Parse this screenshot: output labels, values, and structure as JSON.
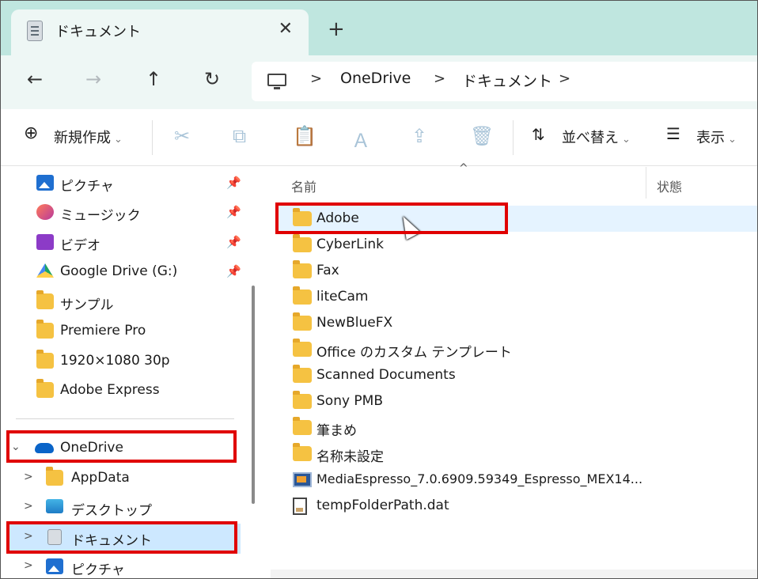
{
  "tab": {
    "title": "ドキュメント",
    "close": "✕",
    "new_tab": "+"
  },
  "nav": {
    "back": "←",
    "forward": "→",
    "up": "↑",
    "refresh": "↻",
    "breadcrumb": [
      "OneDrive",
      "ドキュメント"
    ],
    "separator": ">"
  },
  "toolbar": {
    "new_label": "新規作成",
    "cut_icon": "✂",
    "copy_icon": "⧉",
    "paste_icon": "📋",
    "rename_icon": "Ａ",
    "share_icon": "⇪",
    "delete_icon": "🗑",
    "sort_label": "並べ替え",
    "view_label": "表示",
    "chevron": "⌄"
  },
  "sidebar": {
    "quick_access": [
      {
        "label": "ピクチャ",
        "icon": "pictures-icon",
        "pinned": true
      },
      {
        "label": "ミュージック",
        "icon": "music-icon",
        "pinned": true
      },
      {
        "label": "ビデオ",
        "icon": "videos-icon",
        "pinned": true
      },
      {
        "label": "Google Drive (G:)",
        "icon": "google-drive-icon",
        "pinned": true
      },
      {
        "label": "サンプル",
        "icon": "folder-icon",
        "pinned": false
      },
      {
        "label": "Premiere Pro",
        "icon": "folder-icon",
        "pinned": false
      },
      {
        "label": "1920×1080 30p",
        "icon": "folder-icon",
        "pinned": false
      },
      {
        "label": "Adobe Express",
        "icon": "folder-icon",
        "pinned": false
      }
    ],
    "onedrive": {
      "label": "OneDrive",
      "expanded": true
    },
    "onedrive_children": [
      {
        "label": "AppData",
        "icon": "folder-icon"
      },
      {
        "label": "デスクトップ",
        "icon": "desktop-icon"
      },
      {
        "label": "ドキュメント",
        "icon": "documents-icon",
        "selected": true
      },
      {
        "label": "ピクチャ",
        "icon": "pictures-icon"
      }
    ],
    "pin_glyph": "📌",
    "expand_glyph": ">",
    "collapse_glyph": "⌄"
  },
  "columns": {
    "name": "名前",
    "status": "状態",
    "sort_indicator": "^"
  },
  "files": [
    {
      "name": "Adobe",
      "type": "folder",
      "hover": true
    },
    {
      "name": "CyberLink",
      "type": "folder"
    },
    {
      "name": "Fax",
      "type": "folder"
    },
    {
      "name": "liteCam",
      "type": "folder"
    },
    {
      "name": "NewBlueFX",
      "type": "folder"
    },
    {
      "name": "Office のカスタム テンプレート",
      "type": "folder"
    },
    {
      "name": "Scanned Documents",
      "type": "folder"
    },
    {
      "name": "Sony PMB",
      "type": "folder"
    },
    {
      "name": "筆まめ",
      "type": "folder"
    },
    {
      "name": "名称未設定",
      "type": "folder"
    },
    {
      "name": "MediaEspresso_7.0.6909.59349_Espresso_MEX14...",
      "type": "exe"
    },
    {
      "name": "tempFolderPath.dat",
      "type": "dat"
    }
  ],
  "colors": {
    "highlight": "#e00000",
    "selection": "#cde8ff",
    "hover": "#e5f3ff",
    "tabbar": "#bfe6df"
  }
}
